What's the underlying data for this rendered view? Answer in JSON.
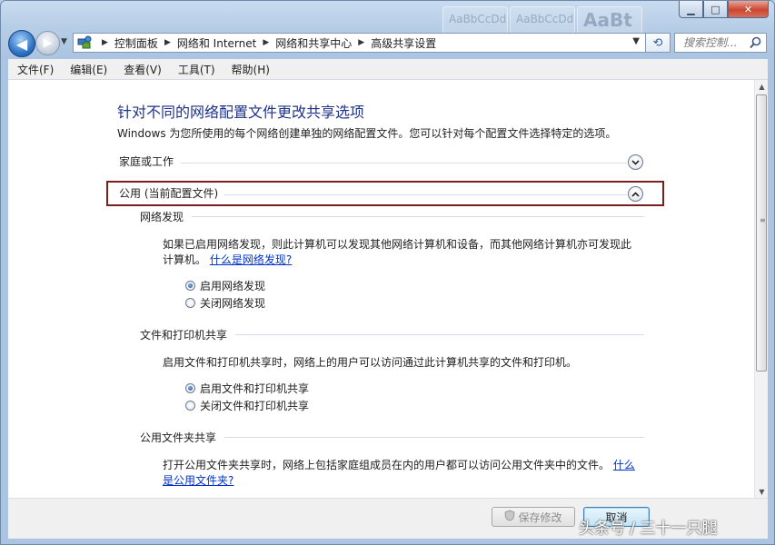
{
  "titlebar": {
    "ghost_tabs": [
      "AaBbCcDd",
      "AaBbCcDd",
      "AaBt"
    ],
    "minimize": "▁",
    "maximize": "□",
    "close": "✕"
  },
  "nav": {
    "back": "◀",
    "forward": "▶",
    "breadcrumb": [
      "控制面板",
      "网络和 Internet",
      "网络和共享中心",
      "高级共享设置"
    ],
    "search_placeholder": "搜索控制..."
  },
  "menu": [
    "文件(F)",
    "编辑(E)",
    "查看(V)",
    "工具(T)",
    "帮助(H)"
  ],
  "page": {
    "title": "针对不同的网络配置文件更改共享选项",
    "subtitle": "Windows 为您所使用的每个网络创建单独的网络配置文件。您可以针对每个配置文件选择特定的选项。",
    "profile_home": "家庭或工作",
    "profile_public": "公用 (当前配置文件)",
    "discovery": {
      "title": "网络发现",
      "desc_1": "如果已启用网络发现，则此计算机可以发现其他网络计算机和设备，而其他网络计算机亦可发现此",
      "desc_2": "计算机。",
      "link": "什么是网络发现?",
      "opt_on": "启用网络发现",
      "opt_off": "关闭网络发现"
    },
    "printer": {
      "title": "文件和打印机共享",
      "desc": "启用文件和打印机共享时，网络上的用户可以访问通过此计算机共享的文件和打印机。",
      "opt_on": "启用文件和打印机共享",
      "opt_off": "关闭文件和打印机共享"
    },
    "public_folder": {
      "title": "公用文件夹共享",
      "desc": "打开公用文件夹共享时，网络上包括家庭组成员在内的用户都可以访问公用文件夹中的文件。",
      "link_1": "什么",
      "link_2": "是公用文件夹?"
    }
  },
  "footer": {
    "save": "保存修改",
    "cancel": "取消",
    "watermark": "头条号 / 三十一只腿"
  }
}
